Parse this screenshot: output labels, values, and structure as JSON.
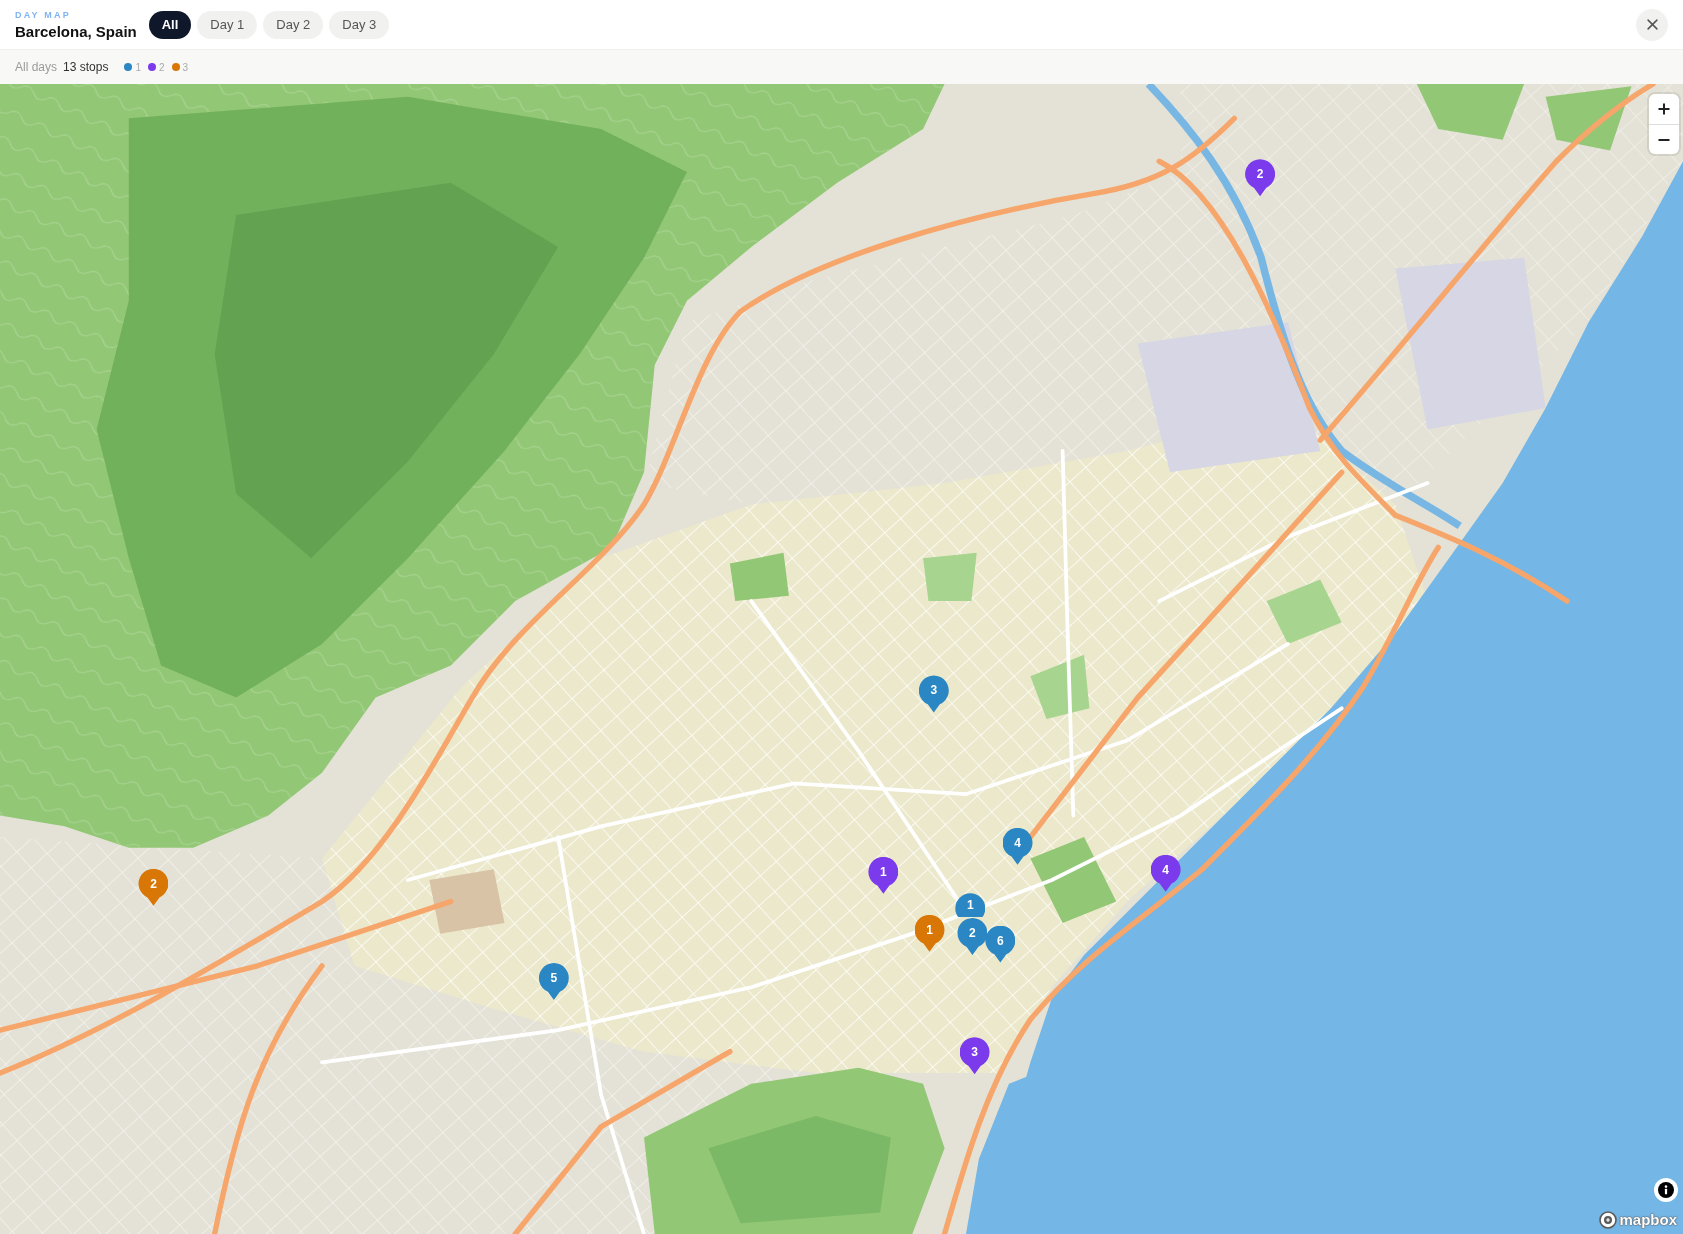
{
  "header": {
    "eyebrow": "DAY MAP",
    "title": "Barcelona, Spain"
  },
  "tabs": [
    {
      "label": "All",
      "selected": true
    },
    {
      "label": "Day 1",
      "selected": false
    },
    {
      "label": "Day 2",
      "selected": false
    },
    {
      "label": "Day 3",
      "selected": false
    }
  ],
  "summary": {
    "scope": "All days",
    "stops": "13 stops"
  },
  "legend": [
    {
      "label": "1",
      "color": "#2b87c3"
    },
    {
      "label": "2",
      "color": "#7c3aed"
    },
    {
      "label": "3",
      "color": "#d97706"
    }
  ],
  "map": {
    "markers": [
      {
        "label": "1",
        "color": "#2b87c3"
      },
      {
        "label": "2",
        "color": "#2b87c3"
      },
      {
        "label": "3",
        "color": "#2b87c3"
      },
      {
        "label": "4",
        "color": "#2b87c3"
      },
      {
        "label": "5",
        "color": "#2b87c3"
      },
      {
        "label": "6",
        "color": "#2b87c3"
      },
      {
        "label": "1",
        "color": "#7c3aed"
      },
      {
        "label": "2",
        "color": "#7c3aed"
      },
      {
        "label": "3",
        "color": "#7c3aed"
      },
      {
        "label": "4",
        "color": "#7c3aed"
      },
      {
        "label": "1",
        "color": "#d97706"
      },
      {
        "label": "2",
        "color": "#d97706"
      }
    ],
    "attribution": "mapbox"
  }
}
